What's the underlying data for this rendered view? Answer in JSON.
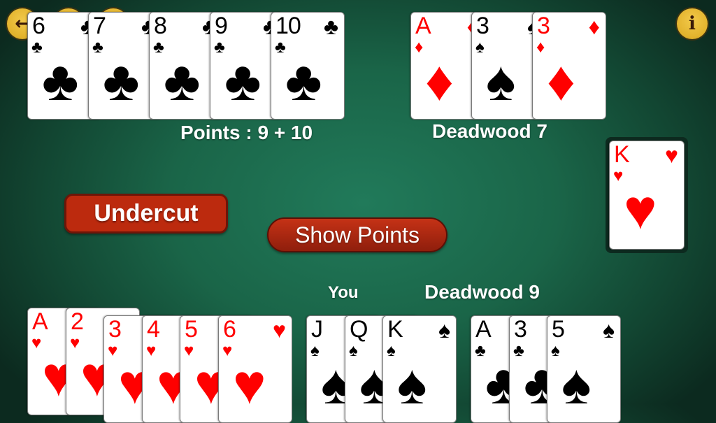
{
  "toolbar": {
    "back_icon": "arrow-left-icon",
    "info_icon": "info-icon",
    "info_glyph": "i"
  },
  "opponent": {
    "points_label": "Points : 9 + 10",
    "deadwood_label": "Deadwood 7",
    "melds": [
      [
        {
          "rank": "6",
          "suit": "♣",
          "color": "black"
        },
        {
          "rank": "7",
          "suit": "♣",
          "color": "black"
        },
        {
          "rank": "8",
          "suit": "♣",
          "color": "black"
        },
        {
          "rank": "9",
          "suit": "♣",
          "color": "black"
        },
        {
          "rank": "10",
          "suit": "♣",
          "color": "black"
        }
      ],
      [
        {
          "rank": "A",
          "suit": "♦",
          "color": "red"
        },
        {
          "rank": "3",
          "suit": "♠",
          "color": "black"
        },
        {
          "rank": "3",
          "suit": "♦",
          "color": "red"
        }
      ]
    ]
  },
  "discard_pile": {
    "top_card": {
      "rank": "K",
      "suit": "♥",
      "color": "red"
    }
  },
  "actions": {
    "undercut_label": "Undercut",
    "show_points_label": "Show Points"
  },
  "player": {
    "name_label": "You",
    "deadwood_label": "Deadwood 9",
    "melds": [
      [
        {
          "rank": "A",
          "suit": "♥",
          "color": "red"
        },
        {
          "rank": "2",
          "suit": "♥",
          "color": "red"
        },
        {
          "rank": "3",
          "suit": "♥",
          "color": "red"
        },
        {
          "rank": "4",
          "suit": "♥",
          "color": "red"
        },
        {
          "rank": "5",
          "suit": "♥",
          "color": "red"
        },
        {
          "rank": "6",
          "suit": "♥",
          "color": "red"
        }
      ],
      [
        {
          "rank": "J",
          "suit": "♠",
          "color": "black"
        },
        {
          "rank": "Q",
          "suit": "♠",
          "color": "black"
        },
        {
          "rank": "K",
          "suit": "♠",
          "color": "black"
        }
      ],
      [
        {
          "rank": "A",
          "suit": "♣",
          "color": "black"
        },
        {
          "rank": "3",
          "suit": "♣",
          "color": "black"
        },
        {
          "rank": "5",
          "suit": "♠",
          "color": "black"
        }
      ]
    ]
  },
  "colors": {
    "felt": "#1a6548",
    "button_red": "#bc2a0e",
    "coin_yellow": "#e2b22c",
    "suit_red": "#ff0000"
  }
}
